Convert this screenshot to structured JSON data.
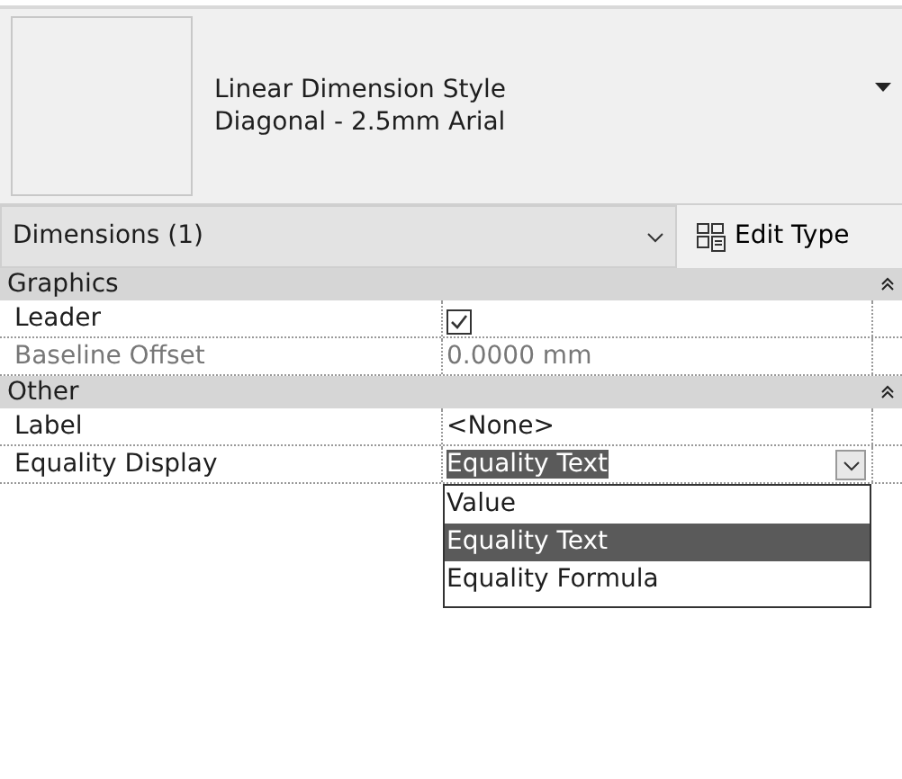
{
  "type_selector": {
    "family": "Linear Dimension Style",
    "type": "Diagonal - 2.5mm Arial"
  },
  "instance_selector": {
    "label": "Dimensions (1)"
  },
  "edit_type_button": "Edit Type",
  "groups": [
    {
      "title": "Graphics",
      "expanded": true,
      "properties": [
        {
          "label": "Leader",
          "kind": "checkbox",
          "checked": true,
          "disabled": false
        },
        {
          "label": "Baseline Offset",
          "kind": "text",
          "value": "0.0000 mm",
          "disabled": true
        }
      ]
    },
    {
      "title": "Other",
      "expanded": true,
      "properties": [
        {
          "label": "Label",
          "kind": "text",
          "value": "<None>",
          "disabled": false
        },
        {
          "label": "Equality Display",
          "kind": "dropdown",
          "value": "Equality Text",
          "disabled": false,
          "open": true,
          "options": [
            {
              "label": "Value",
              "selected": false
            },
            {
              "label": "Equality Text",
              "selected": true
            },
            {
              "label": "Equality Formula",
              "selected": false
            }
          ]
        }
      ]
    }
  ]
}
